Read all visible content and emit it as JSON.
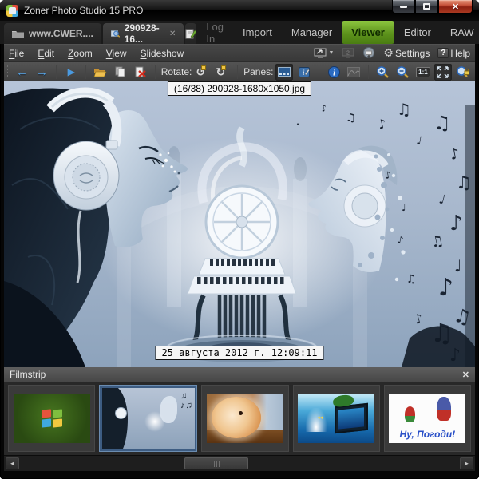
{
  "window": {
    "title": "Zoner Photo Studio 15 PRO"
  },
  "tabs": [
    {
      "label": "www.CWER...."
    },
    {
      "label": "290928-16...",
      "active": true
    }
  ],
  "modes": [
    {
      "label": "Log In"
    },
    {
      "label": "Import"
    },
    {
      "label": "Manager"
    },
    {
      "label": "Viewer",
      "active": true
    },
    {
      "label": "Editor"
    },
    {
      "label": "RAW"
    }
  ],
  "menus": [
    {
      "label": "File"
    },
    {
      "label": "Edit"
    },
    {
      "label": "Zoom"
    },
    {
      "label": "View"
    },
    {
      "label": "Slideshow"
    }
  ],
  "menu_right": {
    "settings_label": "Settings",
    "help_label": "Help"
  },
  "toolbar": {
    "rotate_label": "Rotate:",
    "panes_label": "Panes:",
    "actual_size": "1:1"
  },
  "viewer": {
    "position_tooltip": "(16/38) 290928-1680x1050.jpg",
    "datetime_label": "25 августа 2012 г. 12:09:11"
  },
  "filmstrip": {
    "title": "Filmstrip",
    "thumbnails": [
      {
        "name": "windows-logo-grass-wallpaper"
      },
      {
        "name": "headphones-music-artwork",
        "selected": true
      },
      {
        "name": "hamster-photo"
      },
      {
        "name": "ocean-3d-tv-wallpaper"
      },
      {
        "name": "nu-pogodi-cartoon",
        "caption": "Ну, Погоди!"
      }
    ]
  },
  "icons": {
    "tab_close": "✕",
    "panel_close": "✕",
    "window_close": "✕",
    "back": "←",
    "forward": "→",
    "play": "▶",
    "rotate_left": "↺",
    "rotate_right": "↻",
    "gear": "⚙",
    "help_badge": "?",
    "dropdown_caret": "▼",
    "scroll_left": "◄",
    "scroll_right": "►"
  },
  "colors": {
    "viewer_mode_green": "#5d921c",
    "selection_blue": "#3d5c82",
    "nav_arrow_blue": "#58a6e8",
    "tooltip_bg": "#f6f6f6"
  }
}
